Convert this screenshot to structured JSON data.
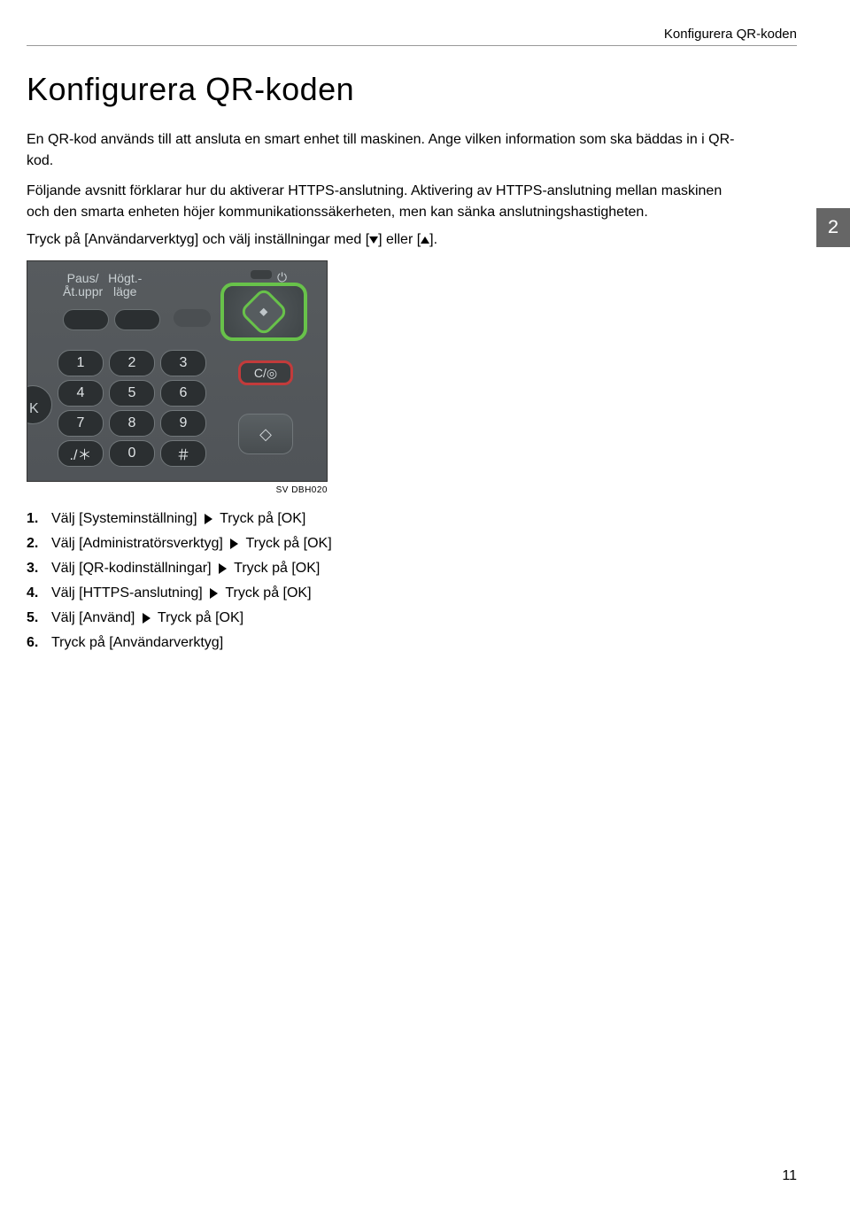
{
  "header": {
    "running_title": "Konfigurera QR-koden"
  },
  "title": "Konfigurera QR-koden",
  "section_number": "2",
  "paragraphs": {
    "p1": "En QR-kod används till att ansluta en smart enhet till maskinen. Ange vilken information som ska bäddas in i QR-kod.",
    "p2": "Följande avsnitt förklarar hur du aktiverar HTTPS-anslutning. Aktivering av HTTPS-anslutning mellan maskinen och den smarta enheten höjer kommunikationssäkerheten, men kan sänka anslutningshastigheten.",
    "instruction_prefix": "Tryck på [Användarverktyg] och välj inställningar med [",
    "instruction_mid": "] eller [",
    "instruction_suffix": "]."
  },
  "figure": {
    "label_paus_line1": "Paus/",
    "label_paus_line2": "Åt.uppr",
    "label_hogt_line1": "Högt.-",
    "label_hogt_line2": "läge",
    "keys": [
      "1",
      "2",
      "3",
      "4",
      "5",
      "6",
      "7",
      "8",
      "9",
      "./＊",
      "0",
      "＃"
    ],
    "side_letter": "K",
    "clear_label": "C/◎",
    "start_glyph": "◇",
    "caption": "SV DBH020"
  },
  "steps": [
    {
      "prefix": "Välj [Systeminställning]",
      "suffix": "Tryck på [OK]"
    },
    {
      "prefix": "Välj [Administratörsverktyg]",
      "suffix": "Tryck på [OK]"
    },
    {
      "prefix": "Välj [QR-kodinställningar]",
      "suffix": "Tryck på [OK]"
    },
    {
      "prefix": "Välj [HTTPS-anslutning]",
      "suffix": "Tryck på [OK]"
    },
    {
      "prefix": "Välj [Använd]",
      "suffix": "Tryck på [OK]"
    },
    {
      "prefix": "Tryck på [Användarverktyg]",
      "suffix": ""
    }
  ],
  "page_number": "11"
}
